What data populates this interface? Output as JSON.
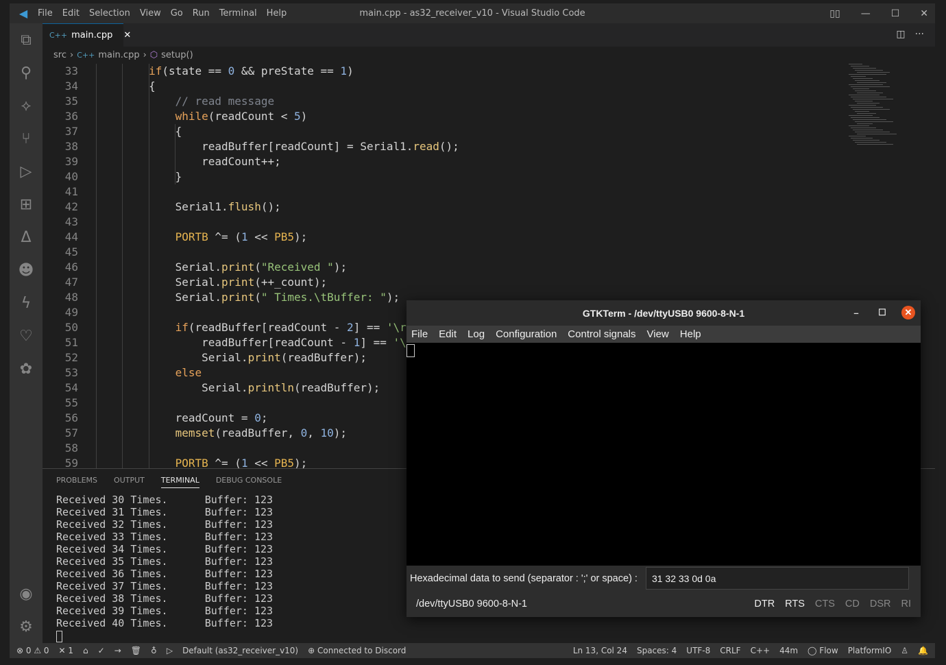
{
  "window": {
    "title": "main.cpp - as32_receiver_v10 - Visual Studio Code",
    "menu": [
      "File",
      "Edit",
      "Selection",
      "View",
      "Go",
      "Run",
      "Terminal",
      "Help"
    ]
  },
  "tab": {
    "label": "main.cpp",
    "icon": "C++"
  },
  "breadcrumb": [
    "src",
    "main.cpp",
    "setup()"
  ],
  "code_lines": [
    {
      "n": "33",
      "t": [
        [
          "",
          "        "
        ],
        [
          "kw",
          "if"
        ],
        [
          "",
          "(state == "
        ],
        [
          "num",
          "0"
        ],
        [
          "",
          " && preState == "
        ],
        [
          "num",
          "1"
        ],
        [
          "",
          ")"
        ]
      ]
    },
    {
      "n": "34",
      "t": [
        [
          "",
          "        {"
        ]
      ]
    },
    {
      "n": "35",
      "t": [
        [
          "",
          "            "
        ],
        [
          "cm",
          "// read message"
        ]
      ]
    },
    {
      "n": "36",
      "t": [
        [
          "",
          "            "
        ],
        [
          "kw",
          "while"
        ],
        [
          "",
          "(readCount < "
        ],
        [
          "num",
          "5"
        ],
        [
          "",
          ")"
        ]
      ]
    },
    {
      "n": "37",
      "t": [
        [
          "",
          "            {"
        ]
      ]
    },
    {
      "n": "38",
      "t": [
        [
          "",
          "                readBuffer[readCount] = Serial1."
        ],
        [
          "fn",
          "read"
        ],
        [
          "",
          "();"
        ]
      ]
    },
    {
      "n": "39",
      "t": [
        [
          "",
          "                readCount++;"
        ]
      ]
    },
    {
      "n": "40",
      "t": [
        [
          "",
          "            }"
        ]
      ]
    },
    {
      "n": "41",
      "t": []
    },
    {
      "n": "42",
      "t": [
        [
          "",
          "            Serial1."
        ],
        [
          "fn",
          "flush"
        ],
        [
          "",
          "();"
        ]
      ]
    },
    {
      "n": "43",
      "t": []
    },
    {
      "n": "44",
      "t": [
        [
          "",
          "            "
        ],
        [
          "mac",
          "PORTB"
        ],
        [
          "",
          " ^= ("
        ],
        [
          "num",
          "1"
        ],
        [
          "",
          " << "
        ],
        [
          "mac",
          "PB5"
        ],
        [
          "",
          ");"
        ]
      ]
    },
    {
      "n": "45",
      "t": []
    },
    {
      "n": "46",
      "t": [
        [
          "",
          "            Serial."
        ],
        [
          "fn",
          "print"
        ],
        [
          "",
          "("
        ],
        [
          "str",
          "\"Received \""
        ],
        [
          "",
          ");"
        ]
      ]
    },
    {
      "n": "47",
      "t": [
        [
          "",
          "            Serial."
        ],
        [
          "fn",
          "print"
        ],
        [
          "",
          "(++_count);"
        ]
      ]
    },
    {
      "n": "48",
      "t": [
        [
          "",
          "            Serial."
        ],
        [
          "fn",
          "print"
        ],
        [
          "",
          "("
        ],
        [
          "str",
          "\" Times.\\tBuffer: \""
        ],
        [
          "",
          ");"
        ]
      ]
    },
    {
      "n": "49",
      "t": []
    },
    {
      "n": "50",
      "t": [
        [
          "",
          "            "
        ],
        [
          "kw",
          "if"
        ],
        [
          "",
          "(readBuffer[readCount - "
        ],
        [
          "num",
          "2"
        ],
        [
          "",
          "] == "
        ],
        [
          "str",
          "'\\r'"
        ]
      ]
    },
    {
      "n": "51",
      "t": [
        [
          "",
          "                readBuffer[readCount - "
        ],
        [
          "num",
          "1"
        ],
        [
          "",
          "] == "
        ],
        [
          "str",
          "'\\n'"
        ]
      ]
    },
    {
      "n": "52",
      "t": [
        [
          "",
          "                Serial."
        ],
        [
          "fn",
          "print"
        ],
        [
          "",
          "(readBuffer);"
        ]
      ]
    },
    {
      "n": "53",
      "t": [
        [
          "",
          "            "
        ],
        [
          "kw",
          "else"
        ]
      ]
    },
    {
      "n": "54",
      "t": [
        [
          "",
          "                Serial."
        ],
        [
          "fn",
          "println"
        ],
        [
          "",
          "(readBuffer);"
        ]
      ]
    },
    {
      "n": "55",
      "t": []
    },
    {
      "n": "56",
      "t": [
        [
          "",
          "            readCount = "
        ],
        [
          "num",
          "0"
        ],
        [
          "",
          ";"
        ]
      ]
    },
    {
      "n": "57",
      "t": [
        [
          "",
          "            "
        ],
        [
          "fn",
          "memset"
        ],
        [
          "",
          "(readBuffer, "
        ],
        [
          "num",
          "0"
        ],
        [
          "",
          ", "
        ],
        [
          "num",
          "10"
        ],
        [
          "",
          ");"
        ]
      ]
    },
    {
      "n": "58",
      "t": []
    },
    {
      "n": "59",
      "t": [
        [
          "",
          "            "
        ],
        [
          "mac",
          "PORTB"
        ],
        [
          "",
          " ^= ("
        ],
        [
          "num",
          "1"
        ],
        [
          "",
          " << "
        ],
        [
          "mac",
          "PB5"
        ],
        [
          "",
          ");"
        ]
      ]
    }
  ],
  "panel": {
    "tabs": [
      "PROBLEMS",
      "OUTPUT",
      "TERMINAL",
      "DEBUG CONSOLE"
    ],
    "active": "TERMINAL",
    "terminal_lines": [
      "Received 30 Times.      Buffer: 123",
      "Received 31 Times.      Buffer: 123",
      "Received 32 Times.      Buffer: 123",
      "Received 33 Times.      Buffer: 123",
      "Received 34 Times.      Buffer: 123",
      "Received 35 Times.      Buffer: 123",
      "Received 36 Times.      Buffer: 123",
      "Received 37 Times.      Buffer: 123",
      "Received 38 Times.      Buffer: 123",
      "Received 39 Times.      Buffer: 123",
      "Received 40 Times.      Buffer: 123"
    ]
  },
  "status": {
    "left": [
      "⊗ 0 ⚠ 0",
      "✕ 1",
      "⌂",
      "✓",
      "→",
      "🗑",
      "♁",
      "▷",
      "Default (as32_receiver_v10)",
      "⊕ Connected to Discord"
    ],
    "right": [
      "Ln 13, Col 24",
      "Spaces: 4",
      "UTF-8",
      "CRLF",
      "C++",
      "44m",
      "◯ Flow",
      "PlatformIO",
      "♙",
      "🔔"
    ]
  },
  "gtkterm": {
    "title": "GTKTerm - /dev/ttyUSB0  9600-8-N-1",
    "menu": [
      "File",
      "Edit",
      "Log",
      "Configuration",
      "Control signals",
      "View",
      "Help"
    ],
    "hex_label": "Hexadecimal data to send (separator : ';' or space) :",
    "hex_value": "31 32 33 0d 0a",
    "port_status": "/dev/ttyUSB0  9600-8-N-1",
    "signals": [
      {
        "label": "DTR",
        "active": true
      },
      {
        "label": "RTS",
        "active": true
      },
      {
        "label": "CTS",
        "active": false
      },
      {
        "label": "CD",
        "active": false
      },
      {
        "label": "DSR",
        "active": false
      },
      {
        "label": "RI",
        "active": false
      }
    ]
  }
}
